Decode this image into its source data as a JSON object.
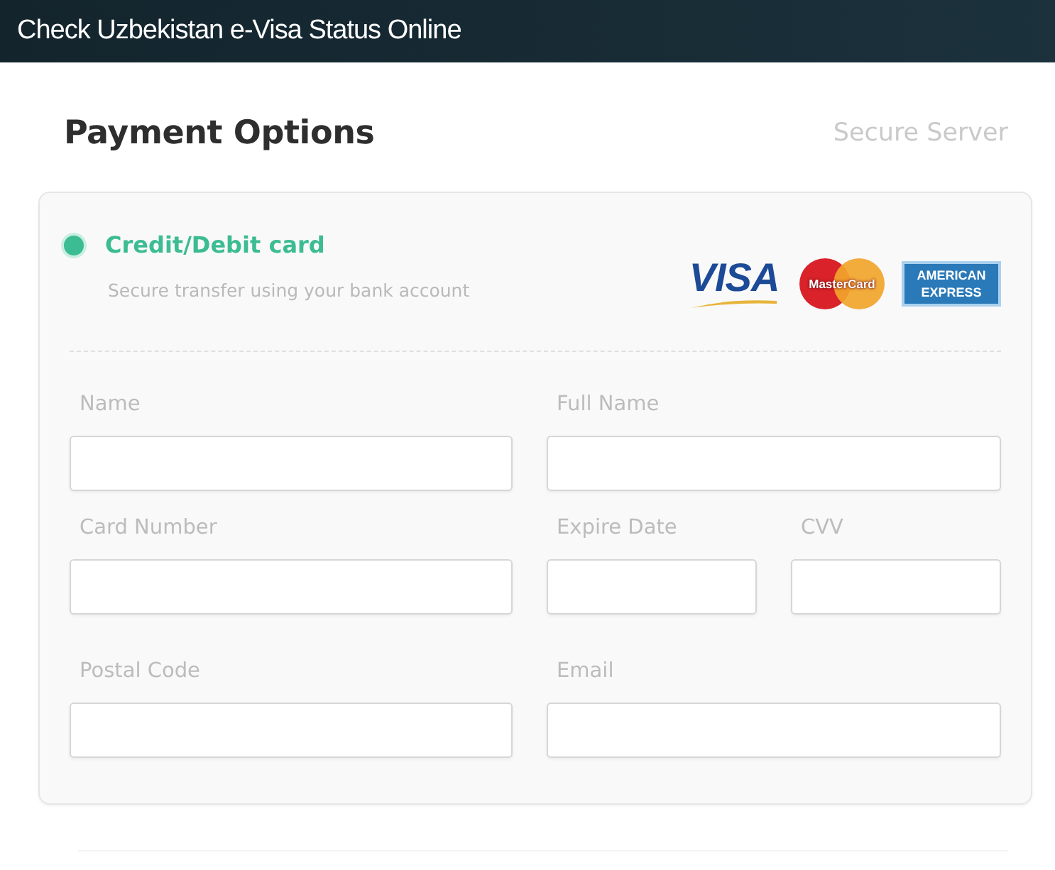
{
  "header": {
    "title": "Check Uzbekistan e-Visa Status Online"
  },
  "page": {
    "heading": "Payment Options",
    "badge": "Secure Server"
  },
  "payment_methods": [
    {
      "label": "Credit/Debit card",
      "description": "Secure transfer using your bank account",
      "selected": true,
      "card_logos": [
        {
          "kind": "visa",
          "text": "VISA"
        },
        {
          "kind": "mastercard",
          "text": "MasterCard"
        },
        {
          "kind": "amex",
          "text": "AMERICAN EXPRESS"
        }
      ],
      "form_rows": [
        [
          {
            "label": "Name"
          },
          {
            "label": "Full Name"
          }
        ],
        [
          {
            "label": "Card Number"
          },
          {
            "label": "Expire Date"
          },
          {
            "label": "CVV"
          }
        ],
        [
          {
            "label": "Postal Code"
          },
          {
            "label": "Email"
          }
        ]
      ]
    }
  ]
}
